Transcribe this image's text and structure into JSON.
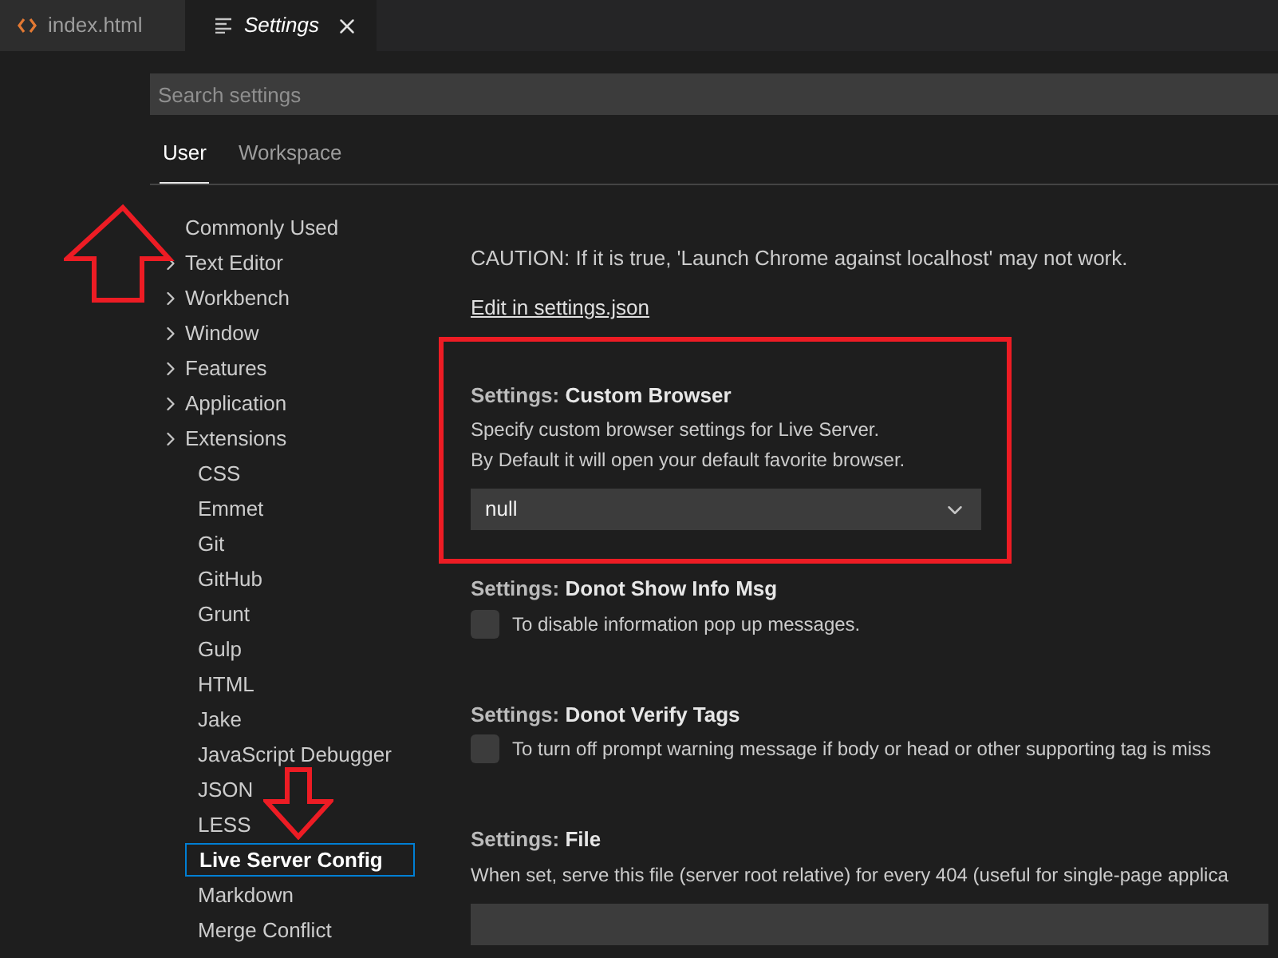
{
  "editor_tabs": [
    {
      "label": "index.html",
      "kind": "html",
      "selected": false
    },
    {
      "label": "Settings",
      "kind": "settings",
      "selected": true
    }
  ],
  "search": {
    "placeholder": "Search settings"
  },
  "scope_tabs": [
    {
      "label": "User",
      "selected": true
    },
    {
      "label": "Workspace",
      "selected": false
    }
  ],
  "toc": [
    {
      "label": "Commonly Used",
      "expandable": false,
      "selected": false
    },
    {
      "label": "Text Editor",
      "expandable": true,
      "selected": false
    },
    {
      "label": "Workbench",
      "expandable": true,
      "selected": false
    },
    {
      "label": "Window",
      "expandable": true,
      "selected": false
    },
    {
      "label": "Features",
      "expandable": true,
      "selected": false
    },
    {
      "label": "Application",
      "expandable": true,
      "selected": false
    },
    {
      "label": "Extensions",
      "expandable": true,
      "selected": false,
      "children": [
        {
          "label": "CSS",
          "selected": false
        },
        {
          "label": "Emmet",
          "selected": false
        },
        {
          "label": "Git",
          "selected": false
        },
        {
          "label": "GitHub",
          "selected": false
        },
        {
          "label": "Grunt",
          "selected": false
        },
        {
          "label": "Gulp",
          "selected": false
        },
        {
          "label": "HTML",
          "selected": false
        },
        {
          "label": "Jake",
          "selected": false
        },
        {
          "label": "JavaScript Debugger",
          "selected": false
        },
        {
          "label": "JSON",
          "selected": false
        },
        {
          "label": "LESS",
          "selected": false
        },
        {
          "label": "Live Server Config",
          "selected": true
        },
        {
          "label": "Markdown",
          "selected": false
        },
        {
          "label": "Merge Conflict",
          "selected": false
        }
      ]
    }
  ],
  "intro": {
    "caution": "CAUTION: If it is true, 'Launch Chrome against localhost' may not work.",
    "link": "Edit in settings.json"
  },
  "settings": [
    {
      "kind": "dropdown",
      "highlighted": true,
      "category": "Settings: ",
      "name": "Custom Browser",
      "description": [
        "Specify custom browser settings for Live Server.",
        "By Default it will open your default favorite browser."
      ],
      "value": "null"
    },
    {
      "kind": "checkbox",
      "highlighted": false,
      "category": "Settings: ",
      "name": "Donot Show Info Msg",
      "description": [
        "To disable information pop up messages."
      ],
      "checked": false
    },
    {
      "kind": "checkbox",
      "highlighted": false,
      "category": "Settings: ",
      "name": "Donot Verify Tags",
      "description": [
        "To turn off prompt warning message if body or head or other supporting tag is miss"
      ],
      "checked": false
    },
    {
      "kind": "text",
      "highlighted": false,
      "category": "Settings: ",
      "name": "File",
      "description": [
        "When set, serve this file (server root relative) for every 404 (useful for single-page applica"
      ]
    }
  ]
}
